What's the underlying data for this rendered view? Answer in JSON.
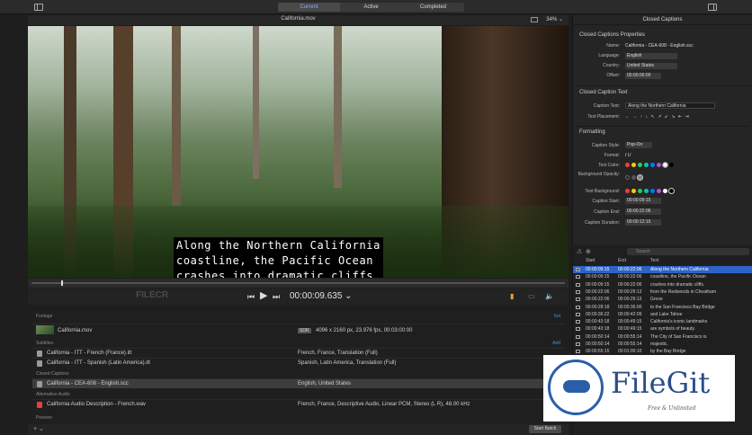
{
  "tabs": [
    "Current",
    "Active",
    "Completed"
  ],
  "viewer": {
    "title": "California.mov",
    "zoom": "34% ⌄"
  },
  "caption_lines": [
    "Along the Northern California",
    "coastline, the Pacific Ocean",
    "crashes into dramatic cliffs."
  ],
  "transport": {
    "timecode": "00:00:09.635 ⌄",
    "watermark": "FILECR"
  },
  "list": {
    "footage_label": "Footage",
    "footage_action": "Set",
    "footage_name": "California.mov",
    "footage_badge": "SDR",
    "footage_info": "4096 x 2160 px, 23.976 fps, 00:03:00:00",
    "subtitles_label": "Subtitles",
    "subtitles_action": "Add",
    "subtitles": [
      {
        "name": "California - ITT - French (France).itt",
        "info": "French, France, Translation (Full)"
      },
      {
        "name": "California - ITT - Spanish (Latin America).itt",
        "info": "Spanish, Latin America, Translation (Full)"
      }
    ],
    "cc_label": "Closed Captions",
    "cc_item": {
      "name": "California - CEA-608 - English.scc",
      "info": "English, United States"
    },
    "audio_label": "Alternative Audio",
    "audio_item": {
      "name": "California Audio Description - French.wav",
      "info": "French, France, Descriptive Audio, Linear PCM, Stereo (L R), 48.00 kHz"
    },
    "preview_label": "Preview"
  },
  "bottom": {
    "start_batch": "Start Batch",
    "plus": "+ ⌄"
  },
  "panel": {
    "title": "Closed Captions",
    "props_heading": "Closed Captions Properties",
    "name_label": "Name:",
    "name_value": "California - CEA-608 - English.scc",
    "language_label": "Language:",
    "language_value": "English",
    "country_label": "Country:",
    "country_value": "United States",
    "offset_label": "Offset:",
    "offset_value": "00:00:00:00",
    "text_heading": "Closed Caption Text",
    "caption_text_label": "Caption Text:",
    "caption_text_value": "Along the Northern California",
    "placement_label": "Text Placement:",
    "placement_value": "← → ↑ ↓ ↖ ↗ ↙ ↘ ⇤ ⇥",
    "format_heading": "Formatting",
    "style_label": "Caption Style:",
    "style_value": "Pop-On",
    "format_label": "Format:",
    "format_value": "I  U",
    "text_color_label": "Text Color:",
    "bg_opacity_label": "Background Opacity:",
    "text_bg_label": "Text Background:",
    "start_label": "Caption Start:",
    "start_value": "00:00:09:15",
    "end_label": "Caption End:",
    "end_value": "00:00:22:06",
    "duration_label": "Caption Duration:",
    "duration_value": "00:00:12:15"
  },
  "colors": [
    "#ff3b30",
    "#ffcc00",
    "#34c759",
    "#00c7be",
    "#007aff",
    "#af52de",
    "#ffffff",
    "#000000"
  ],
  "clist": {
    "search_placeholder": "Search",
    "headers": {
      "start": "Start",
      "end": "End",
      "text": "Text"
    },
    "rows": [
      {
        "start": "00:00:09:15",
        "end": "00:00:22:06",
        "text": "Along the Northern California"
      },
      {
        "start": "00:00:09:15",
        "end": "00:00:22:06",
        "text": "coastline, the Pacific Ocean"
      },
      {
        "start": "00:00:09:15",
        "end": "00:00:22:06",
        "text": "crashes into dramatic cliffs."
      },
      {
        "start": "00:00:22:06",
        "end": "00:00:29:13",
        "text": "from the Redwoods in Cheatham"
      },
      {
        "start": "00:00:22:06",
        "end": "00:00:29:13",
        "text": "Grove"
      },
      {
        "start": "00:00:28:18",
        "end": "00:00:36:00",
        "text": "to the San Francisco Bay Bridge"
      },
      {
        "start": "00:00:36:22",
        "end": "00:00:42:09",
        "text": "and Lake Tahoe"
      },
      {
        "start": "00:00:43:18",
        "end": "00:00:49:15",
        "text": "California's iconic landmarks"
      },
      {
        "start": "00:00:43:18",
        "end": "00:00:49:15",
        "text": "are symbols of beauty."
      },
      {
        "start": "00:00:50:14",
        "end": "00:00:55:14",
        "text": "The City of San Francisco is"
      },
      {
        "start": "00:00:50:14",
        "end": "00:00:55:14",
        "text": "majestic."
      },
      {
        "start": "00:00:55:15",
        "end": "00:01:00:10",
        "text": "by the Bay Bridge"
      }
    ]
  },
  "filegit": {
    "name": "FileGit",
    "tagline": "Free & Unlimited"
  }
}
